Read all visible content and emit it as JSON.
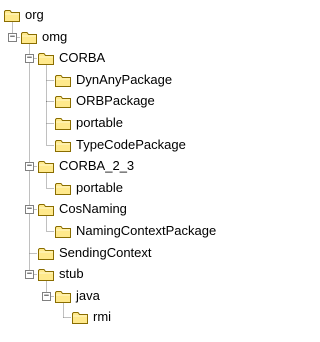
{
  "tree": {
    "colors": {
      "folder_fill": "#ffe98c",
      "folder_stroke": "#8a6d00",
      "line": "#808080"
    },
    "nodes": [
      {
        "label": "org",
        "depth": 0,
        "expander": "none",
        "last": true
      },
      {
        "label": "omg",
        "depth": 1,
        "expander": "minus",
        "last": true
      },
      {
        "label": "CORBA",
        "depth": 2,
        "expander": "minus",
        "last": false
      },
      {
        "label": "DynAnyPackage",
        "depth": 3,
        "expander": "none",
        "last": false
      },
      {
        "label": "ORBPackage",
        "depth": 3,
        "expander": "none",
        "last": false
      },
      {
        "label": "portable",
        "depth": 3,
        "expander": "none",
        "last": false
      },
      {
        "label": "TypeCodePackage",
        "depth": 3,
        "expander": "none",
        "last": true
      },
      {
        "label": "CORBA_2_3",
        "depth": 2,
        "expander": "minus",
        "last": false
      },
      {
        "label": "portable",
        "depth": 3,
        "expander": "none",
        "last": true
      },
      {
        "label": "CosNaming",
        "depth": 2,
        "expander": "minus",
        "last": false
      },
      {
        "label": "NamingContextPackage",
        "depth": 3,
        "expander": "none",
        "last": true
      },
      {
        "label": "SendingContext",
        "depth": 2,
        "expander": "none",
        "last": false
      },
      {
        "label": "stub",
        "depth": 2,
        "expander": "minus",
        "last": true
      },
      {
        "label": "java",
        "depth": 3,
        "expander": "minus",
        "last": true
      },
      {
        "label": "rmi",
        "depth": 4,
        "expander": "none",
        "last": true
      }
    ]
  }
}
